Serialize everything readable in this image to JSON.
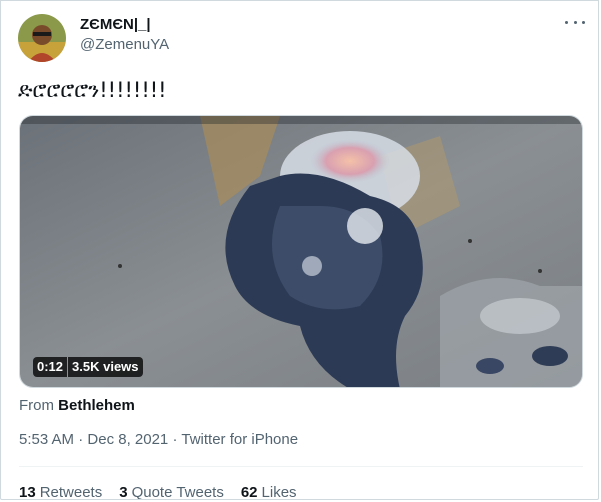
{
  "author": {
    "name": "ZЄMЄN|_|",
    "handle": "@ZemenuYA",
    "avatar_icon": "profile-photo"
  },
  "tweet": {
    "text": "ድሮሮሮሮን!!!!!!!!"
  },
  "media": {
    "type": "video",
    "duration": "0:12",
    "views": "3.5K views"
  },
  "location": {
    "prefix": "From",
    "place": "Bethlehem"
  },
  "meta": {
    "time": "5:53 AM",
    "separator1": "·",
    "date": "Dec 8, 2021",
    "separator2": "·",
    "source": "Twitter for iPhone"
  },
  "stats": {
    "retweets_count": "13",
    "retweets_label": "Retweets",
    "quotes_count": "3",
    "quotes_label": "Quote Tweets",
    "likes_count": "62",
    "likes_label": "Likes"
  },
  "colors": {
    "text_primary": "#0f1419",
    "text_secondary": "#536471",
    "border": "#cfd9de"
  }
}
